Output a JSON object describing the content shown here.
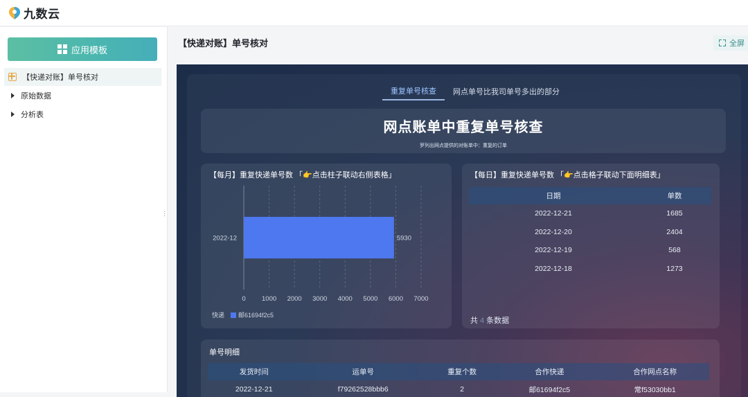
{
  "app": {
    "logo_text": "九数云"
  },
  "sidebar": {
    "template_button": "应用模板",
    "items": [
      {
        "label": "【快递对账】单号核对",
        "active": true,
        "icon": "table-icon"
      },
      {
        "label": "原始数据",
        "icon": "caret-right-icon"
      },
      {
        "label": "分析表",
        "icon": "caret-right-icon"
      }
    ]
  },
  "main": {
    "title": "【快递对账】单号核对",
    "fullscreen_label": "全屏"
  },
  "dashboard": {
    "tabs": [
      {
        "label": "重复单号核查",
        "active": true
      },
      {
        "label": "网点单号比我司单号多出的部分",
        "active": false
      }
    ],
    "title": "网点账单中重复单号核查",
    "subtitle": "罗列出网点提供的对账单中：重复的订单",
    "monthly_card": {
      "title": "【每月】重复快递单号数 「👉点击柱子联动右侧表格」"
    },
    "daily_card": {
      "title": "【每日】重复快递单号数 「👉点击格子联动下面明细表」",
      "columns": [
        "日期",
        "单数"
      ],
      "rows": [
        [
          "2022-12-21",
          "1685"
        ],
        [
          "2022-12-20",
          "2404"
        ],
        [
          "2022-12-19",
          "568"
        ],
        [
          "2022-12-18",
          "1273"
        ]
      ],
      "count_prefix": "共",
      "count_value": "4",
      "count_suffix": "条数据"
    },
    "detail_card": {
      "title": "单号明细",
      "columns": [
        "发货时间",
        "运单号",
        "重复个数",
        "合作快递",
        "合作网点名称"
      ],
      "rows": [
        [
          "2022-12-21",
          "f79262528bbb6",
          "2",
          "邮61694f2c5",
          "常f53030bb1"
        ]
      ]
    }
  },
  "chart_data": {
    "type": "bar",
    "orientation": "horizontal",
    "categories": [
      "2022-12"
    ],
    "series": [
      {
        "name": "邮61694f2c5",
        "values": [
          5930
        ]
      }
    ],
    "legend_title": "快递",
    "xlim": [
      0,
      7000
    ],
    "xticks": [
      0,
      1000,
      2000,
      3000,
      4000,
      5000,
      6000,
      7000
    ],
    "bar_color": "#4e78ef",
    "grid": true
  },
  "colors": {
    "accent": "#4bb6b0",
    "bar": "#4e78ef",
    "tab_active": "#9cc4ff"
  }
}
